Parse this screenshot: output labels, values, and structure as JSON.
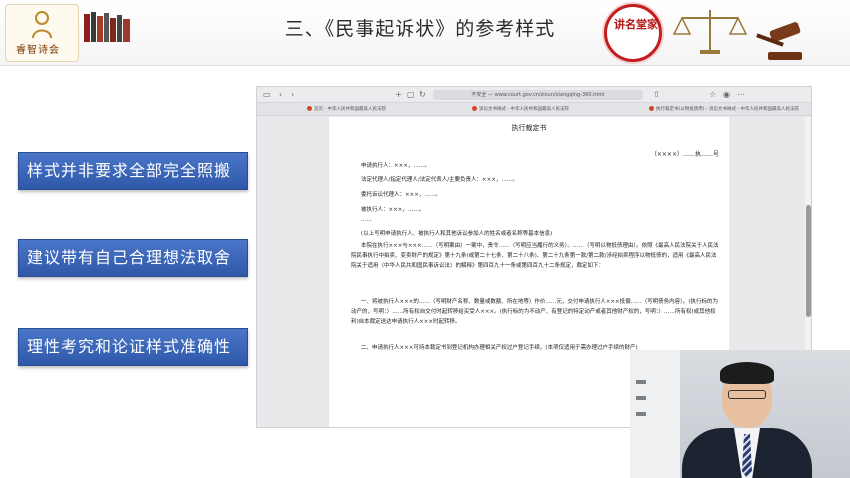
{
  "header": {
    "title": "三、《民事起诉状》的参考样式",
    "logo_left_text": "睿智诗会",
    "brand_seal_text": "讲名堂家"
  },
  "points": [
    "样式并非要求全部完全照搬",
    "建议带有自己合理想法取舍",
    "理性考究和论证样式准确性"
  ],
  "browser": {
    "url": "不安全 — www.court.gov.cn/zixun/xiangqing-360.html",
    "tabs": [
      "首页 - 中华人民共和国最高人民法院",
      "诉讼文书样式 - 中华人民共和国最高人民法院",
      "执行裁定书(以物抵债用) - 诉讼文书样式 - 中华人民共和国最高人民法院"
    ],
    "doc": {
      "title": "执行裁定书",
      "case_no": "（××××）……执……号",
      "lines": [
        "申请执行人：×××，……。",
        "法定代理人/指定代理人/法定代表人/主要负责人：×××，……。",
        "委托诉讼代理人：×××，……。",
        "被执行人：×××，……。",
        "……",
        "(以上写明申请执行人、被执行人和其他诉讼参加人的姓名或者名称等基本信息)"
      ],
      "para1": "本院在执行×××与×××……（写明案由）一案中，责令……（写明应当履行的义务）。……（写明以物抵债理由）。依照《最高人民法院关于人民法院民事执行中拍卖、变卖财产的规定》第十九条(或第二十七条、第二十八条)、第二十九条第一款/第二款/涉经拍卖程序以物抵债的，适用《最高人民法院关于适用〈中华人民共和国民事诉讼法〉的解释》第四百九十一条或第四百九十二条规定，裁定如下：",
      "para2": "一、将被执行人×××的……（写明财产名称、数量或数额、所在地等）作价……元，交付申请执行人×××抵偿……（写明债务内容）。(执行标的为动产的，写明：）……所有权自交付时起转移给买受人×××。(执行标的为不动产、有登记的特定动产或者其他财产权的，写明：）……所有权(或其他权利)自本裁定送达申请执行人×××时起转移。",
      "para3": "二、申请执行人×××可持本裁定书到登记机构办理相关产权过户登记手续。(本项仅适用于需办理过户手续的财产)"
    }
  }
}
